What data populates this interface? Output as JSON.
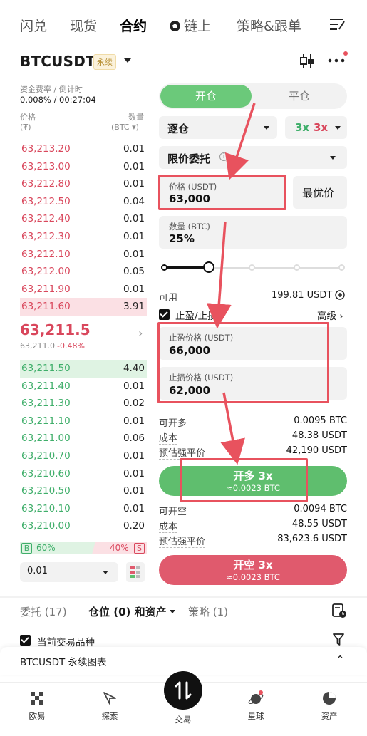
{
  "top_tabs": [
    "闪兑",
    "现货",
    "合约",
    "链上",
    "策略&跟单"
  ],
  "header": {
    "symbol": "BTCUSDT",
    "badge": "永续"
  },
  "funding": {
    "label": "资金费率 / 倒计时",
    "value": "0.008% / 00:27:04"
  },
  "orderbook": {
    "price_label": "价格",
    "price_unit": "(₮)",
    "qty_label": "数量",
    "qty_unit": "(BTC ▾)",
    "asks": [
      {
        "p": "63,213.20",
        "q": "0.01"
      },
      {
        "p": "63,213.00",
        "q": "0.01"
      },
      {
        "p": "63,212.80",
        "q": "0.01"
      },
      {
        "p": "63,212.50",
        "q": "0.04"
      },
      {
        "p": "63,212.40",
        "q": "0.01"
      },
      {
        "p": "63,212.30",
        "q": "0.01"
      },
      {
        "p": "63,212.10",
        "q": "0.01"
      },
      {
        "p": "63,212.00",
        "q": "0.05"
      },
      {
        "p": "63,211.90",
        "q": "0.01"
      },
      {
        "p": "63,211.60",
        "q": "3.91"
      }
    ],
    "last_price": "63,211.5",
    "mark_price": "63,211.0",
    "change": "-0.48%",
    "bids": [
      {
        "p": "63,211.50",
        "q": "4.40"
      },
      {
        "p": "63,211.40",
        "q": "0.01"
      },
      {
        "p": "63,211.30",
        "q": "0.02"
      },
      {
        "p": "63,211.10",
        "q": "0.01"
      },
      {
        "p": "63,211.00",
        "q": "0.06"
      },
      {
        "p": "63,210.70",
        "q": "0.01"
      },
      {
        "p": "63,210.60",
        "q": "0.01"
      },
      {
        "p": "63,210.50",
        "q": "0.01"
      },
      {
        "p": "63,210.10",
        "q": "0.01"
      },
      {
        "p": "63,210.00",
        "q": "0.20"
      }
    ],
    "buy_tag": "B",
    "buy_ratio": "60%",
    "sell_ratio": "40%",
    "sell_tag": "S",
    "precision": "0.01"
  },
  "form": {
    "open_tab": "开仓",
    "close_tab": "平仓",
    "margin_mode": "逐仓",
    "lev_long": "3x",
    "lev_short": "3x",
    "order_type": "限价委托",
    "price_label": "价格 (USDT)",
    "price_value": "63,000",
    "best_price": "最优价",
    "qty_label": "数量 (BTC)",
    "qty_value": "25%",
    "available_label": "可用",
    "available_value": "199.81 USDT",
    "tpsl_label": "止盈/止损",
    "advanced": "高级 ›",
    "tp_label": "止盈价格 (USDT)",
    "tp_value": "66,000",
    "sl_label": "止损价格 (USDT)",
    "sl_value": "62,000",
    "long_rows": [
      {
        "k": "可开多",
        "v": "0.0095 BTC"
      },
      {
        "k": "成本",
        "v": "48.38 USDT"
      },
      {
        "k": "预估强平价",
        "v": "42,190 USDT"
      }
    ],
    "long_btn": "开多 3x",
    "long_sub": "≈0.0023 BTC",
    "short_rows": [
      {
        "k": "可开空",
        "v": "0.0094 BTC"
      },
      {
        "k": "成本",
        "v": "48.55 USDT"
      },
      {
        "k": "预估强平价",
        "v": "83,623.6 USDT"
      }
    ],
    "short_btn": "开空 3x",
    "short_sub": "≈0.0023 BTC"
  },
  "bottom_tabs": {
    "orders": "委托 (17)",
    "positions": "仓位 (0) 和资产",
    "strategy": "策略 (1)"
  },
  "filter_label": "当前交易品种",
  "chart_bar": "BTCUSDT 永续图表",
  "nav": [
    "欧易",
    "探索",
    "交易",
    "星球",
    "资产"
  ],
  "colors": {
    "long": "#5fbe6e",
    "short": "#e05a6d",
    "annotation": "#e8525e"
  }
}
